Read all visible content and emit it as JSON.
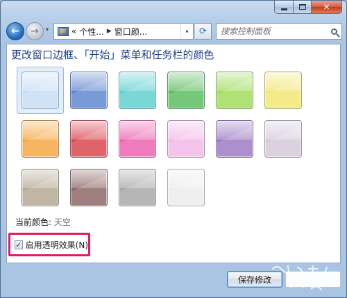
{
  "titlebar": {
    "minimize_label": "minimize",
    "maximize_label": "maximize",
    "close_glyph": "✕"
  },
  "nav": {
    "back_glyph": "←",
    "forward_glyph": "→",
    "dropdown_glyph": "▾",
    "refresh_glyph": "⟳"
  },
  "address": {
    "overflow": "«",
    "segments": [
      "个性...",
      "窗口颜..."
    ],
    "separator": "▶",
    "arrow": "▾"
  },
  "search": {
    "placeholder": "搜索控制面板"
  },
  "content": {
    "heading": "更改窗口边框、「开始」菜单和任务栏的颜色",
    "swatches": [
      {
        "color": "#c6dcf5",
        "selected": true
      },
      {
        "color": "#5b84cf",
        "selected": false
      },
      {
        "color": "#5ccfd0",
        "selected": false
      },
      {
        "color": "#57bb5c",
        "selected": false
      },
      {
        "color": "#9edb56",
        "selected": false
      },
      {
        "color": "#f2e66f",
        "selected": false
      },
      {
        "color": "#f6a540",
        "selected": false
      },
      {
        "color": "#d8424a",
        "selected": false
      },
      {
        "color": "#ec5faf",
        "selected": false
      },
      {
        "color": "#f2b7e6",
        "selected": false
      },
      {
        "color": "#9a78c2",
        "selected": false
      },
      {
        "color": "#d5c7db",
        "selected": false
      },
      {
        "color": "#b4a78f",
        "selected": false
      },
      {
        "color": "#8a6463",
        "selected": false
      },
      {
        "color": "#a6a6a6",
        "selected": false
      },
      {
        "color": "#ececec",
        "selected": false
      }
    ],
    "current_color_label": "当前颜色:",
    "current_color_value": "天空",
    "transparency_label": "启用透明效果(N)",
    "transparency_checked": "✓"
  },
  "buttons": {
    "save_label": "保存修改",
    "cancel_label": ""
  },
  "colors": {
    "accent_heading": "#1e3f8f",
    "highlight_border": "#e21a66"
  }
}
